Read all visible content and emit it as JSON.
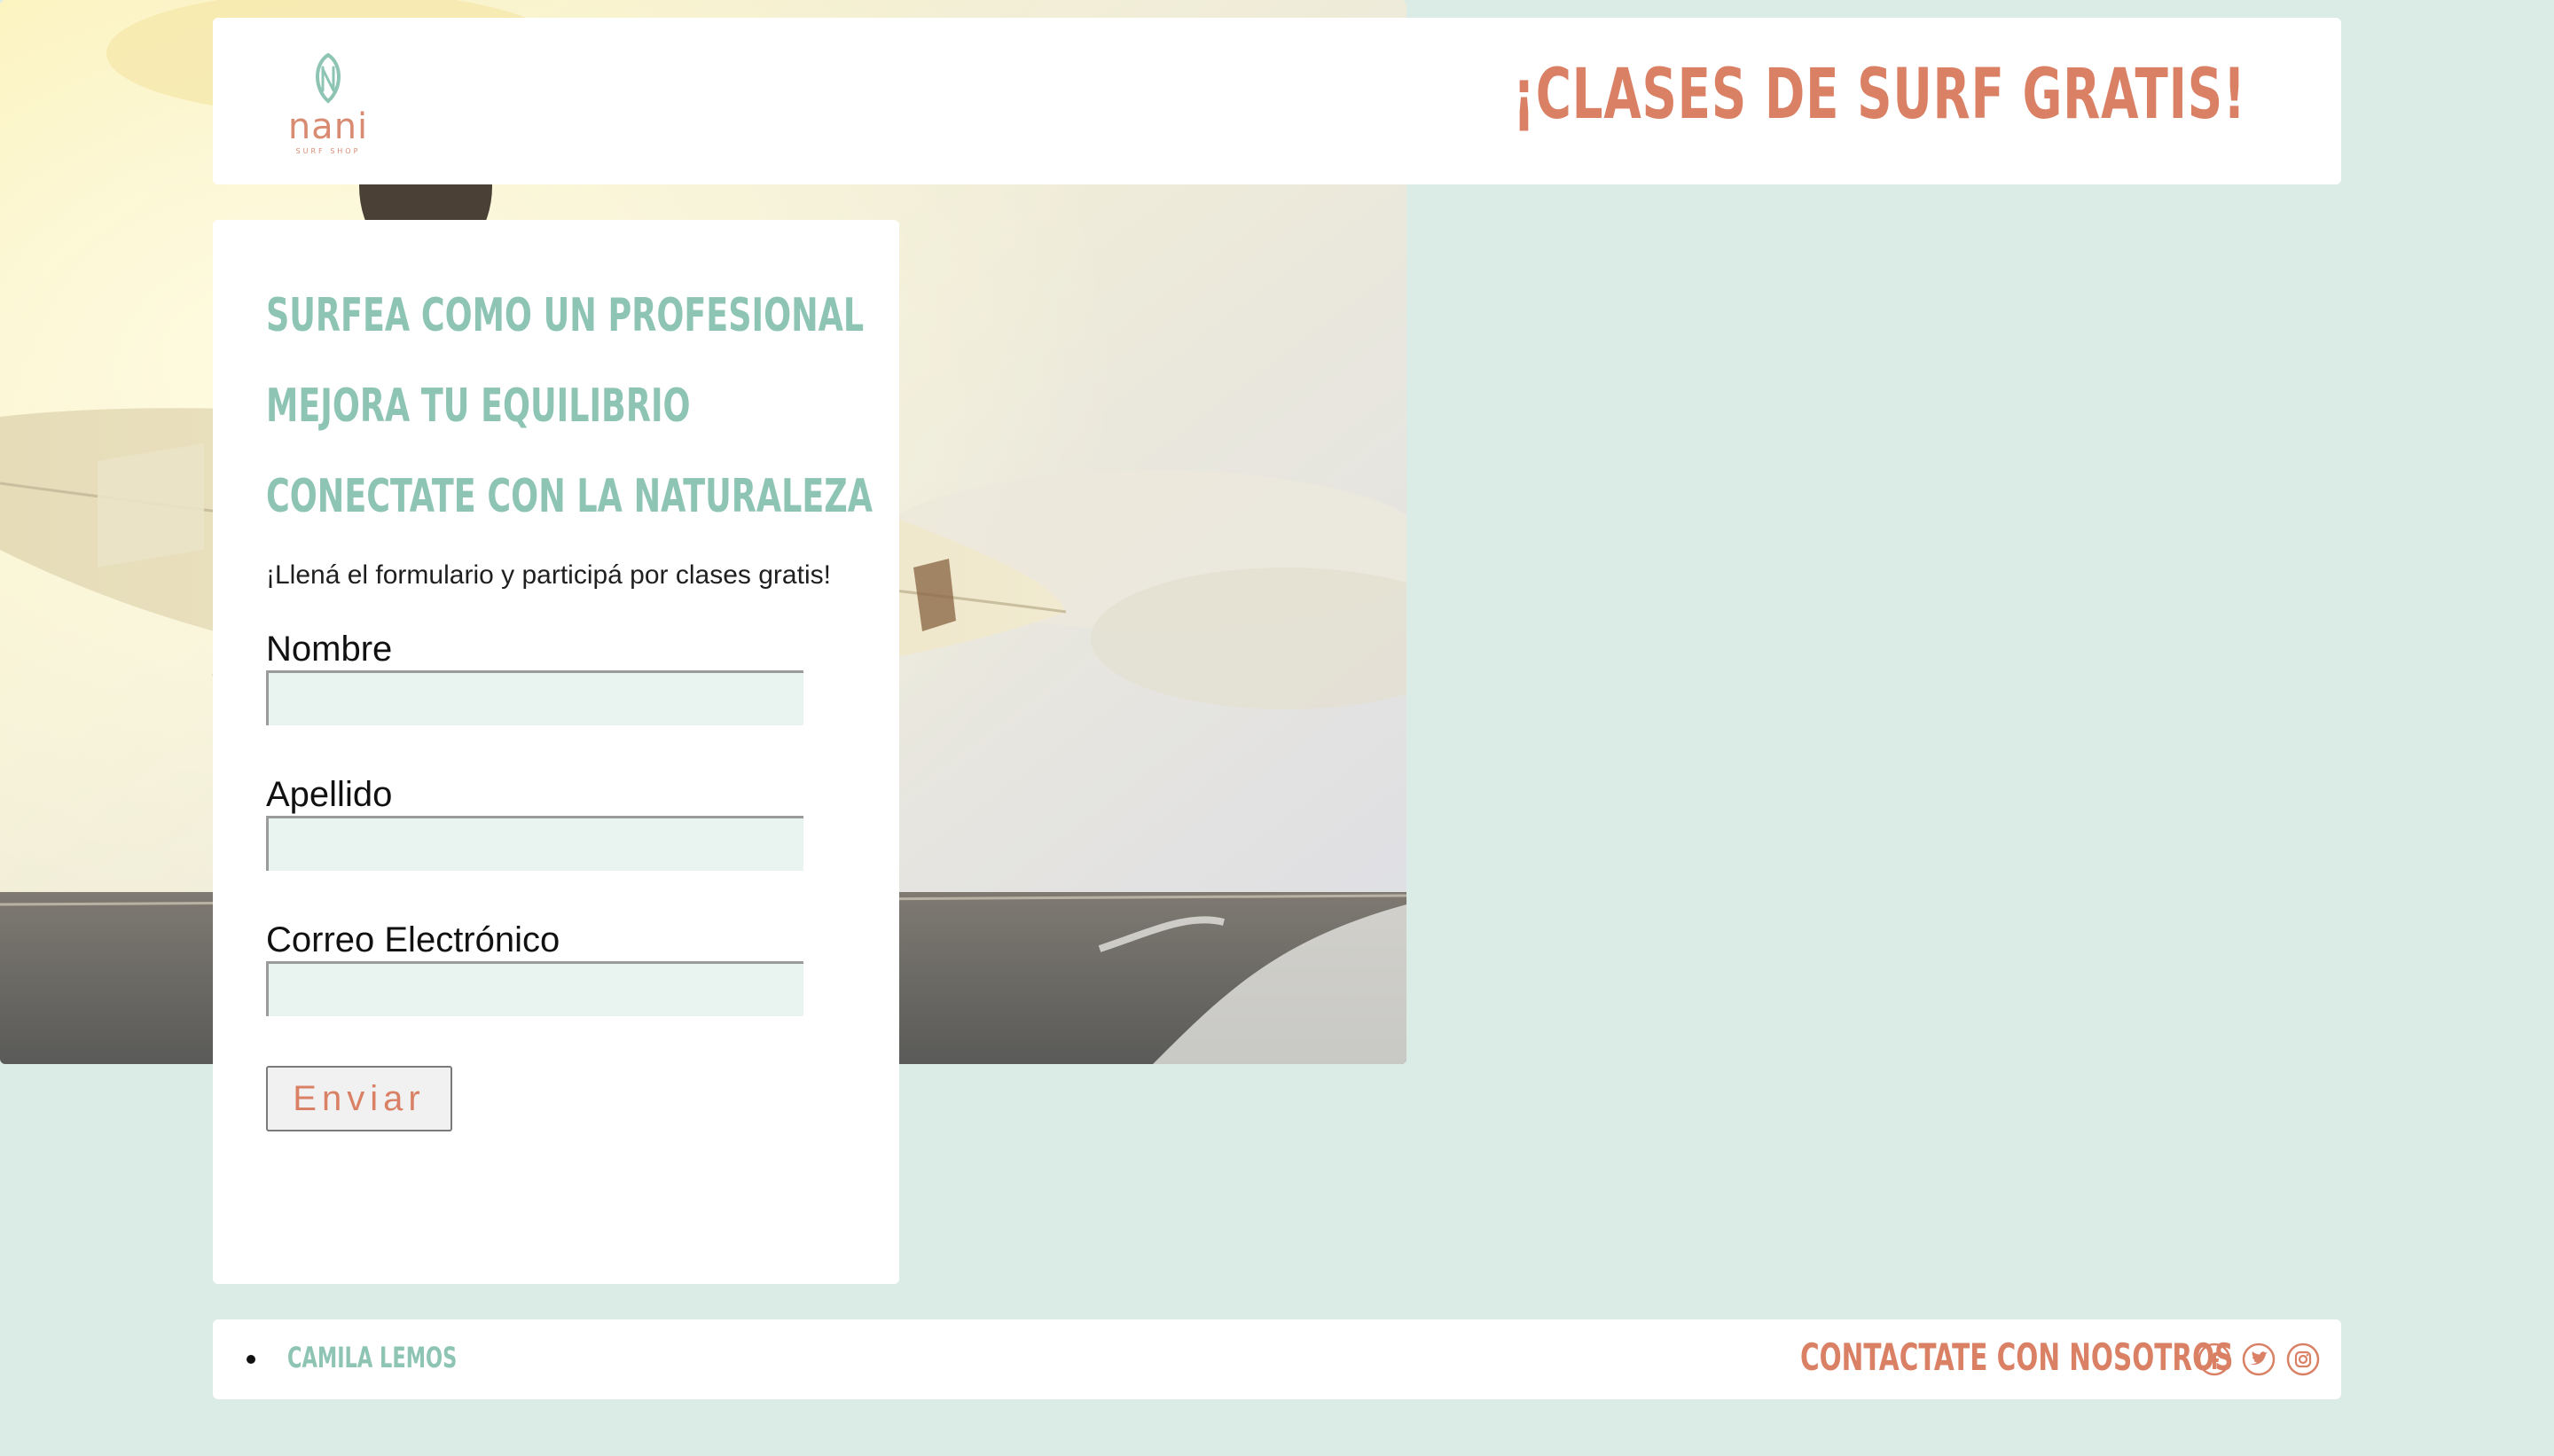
{
  "brand": {
    "logo_name": "nani",
    "logo_tagline": "SURF SHOP",
    "accent_color": "#d98065",
    "secondary_color": "#8dc4b3"
  },
  "header": {
    "title": "¡CLASES DE SURF GRATIS!"
  },
  "benefits": [
    "SURFEA COMO UN PROFESIONAL",
    "MEJORA TU EQUILIBRIO",
    "CONECTATE CON LA NATURALEZA"
  ],
  "form": {
    "intro": "¡Llená el formulario y participá por clases gratis!",
    "fields": [
      {
        "label": "Nombre",
        "value": ""
      },
      {
        "label": "Apellido",
        "value": ""
      },
      {
        "label": "Correo Electrónico",
        "value": ""
      }
    ],
    "submit_label": "Enviar"
  },
  "footer": {
    "author": "CAMILA LEMOS",
    "contact": "CONTACTATE CON NOSOTROS",
    "social_icons": [
      "facebook-icon",
      "twitter-icon",
      "instagram-icon"
    ]
  }
}
